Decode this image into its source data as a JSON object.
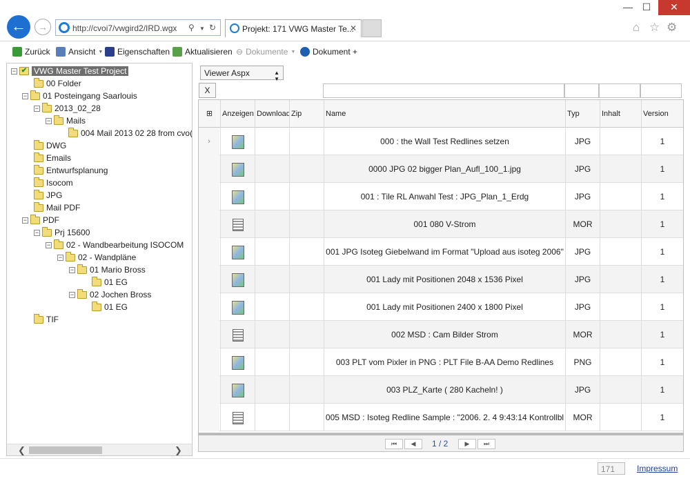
{
  "browser": {
    "url": "http://cvoi7/vwgird2/IRD.wgx",
    "tab_title": "Projekt: 171 VWG Master Te...",
    "win_minimize": "—",
    "win_maximize": "☐",
    "win_close": "✕",
    "tab_close": "✕"
  },
  "toolbar": {
    "back": "Zurück",
    "view": "Ansicht",
    "properties": "Eigenschaften",
    "refresh": "Aktualisieren",
    "documents": "Dokumente",
    "add_document": "Dokument +"
  },
  "tree": {
    "nodes": [
      {
        "label": "VWG Master Test Project"
      },
      {
        "label": "00 Folder"
      },
      {
        "label": "01 Posteingang Saarlouis"
      },
      {
        "label": "2013_02_28"
      },
      {
        "label": "Mails"
      },
      {
        "label": "004 Mail 2013 02 28 from cvo("
      },
      {
        "label": "DWG"
      },
      {
        "label": "Emails"
      },
      {
        "label": "Entwurfsplanung"
      },
      {
        "label": "Isocom"
      },
      {
        "label": "JPG"
      },
      {
        "label": "Mail PDF"
      },
      {
        "label": "PDF"
      },
      {
        "label": "Prj 15600"
      },
      {
        "label": "02 - Wandbearbeitung ISOCOM"
      },
      {
        "label": "02 - Wandpläne"
      },
      {
        "label": "01 Mario Bross"
      },
      {
        "label": "01 EG"
      },
      {
        "label": "02 Jochen Bross"
      },
      {
        "label": "01 EG"
      },
      {
        "label": "TIF"
      }
    ]
  },
  "viewer": {
    "selected": "Viewer Aspx",
    "clear_filter": "X"
  },
  "grid": {
    "columns": [
      "Anzeigen",
      "Download",
      "Zip",
      "Name",
      "Typ",
      "Inhalt",
      "Version"
    ],
    "rows": [
      {
        "name": "000 : the Wall Test Redlines setzen",
        "type": "JPG",
        "version": "1",
        "icon": "image-file-icon"
      },
      {
        "name": "0000 JPG 02 bigger Plan_Aufl_100_1.jpg",
        "type": "JPG",
        "version": "1",
        "icon": "image-file-icon"
      },
      {
        "name": "001 : Tile RL Anwahl Test : JPG_Plan_1_Erdg",
        "type": "JPG",
        "version": "1",
        "icon": "image-file-icon"
      },
      {
        "name": "001 080 V-Strom",
        "type": "MOR",
        "version": "1",
        "icon": "document-file-icon"
      },
      {
        "name": "001 JPG Isoteg Giebelwand im Format \"Upload aus isoteg 2006\"",
        "type": "JPG",
        "version": "1",
        "icon": "image-file-icon"
      },
      {
        "name": "001 Lady mit Positionen 2048 x 1536 Pixel",
        "type": "JPG",
        "version": "1",
        "icon": "image-file-icon"
      },
      {
        "name": "001 Lady mit Positionen 2400 x 1800 Pixel",
        "type": "JPG",
        "version": "1",
        "icon": "image-file-icon"
      },
      {
        "name": "002 MSD : Cam Bilder Strom",
        "type": "MOR",
        "version": "1",
        "icon": "document-file-icon"
      },
      {
        "name": "003 PLT vom Pixler in PNG : PLT File B-AA Demo Redlines",
        "type": "PNG",
        "version": "1",
        "icon": "image-file-icon"
      },
      {
        "name": "003 PLZ_Karte ( 280 Kacheln! )",
        "type": "JPG",
        "version": "1",
        "icon": "image-file-icon"
      },
      {
        "name": "005 MSD : Isoteg Redline Sample : \"2006. 2. 4  9:43:14 Kontrollbl",
        "type": "MOR",
        "version": "1",
        "icon": "document-file-icon"
      }
    ]
  },
  "pager": {
    "page_info": "1 / 2",
    "first": "⏮",
    "prev": "◀",
    "next": "▶",
    "last": "⏭"
  },
  "status": {
    "count": "171",
    "impressum": "Impressum"
  },
  "colors": {
    "accent": "#1d6fd1",
    "selected_node": "#6e6e6e",
    "link": "#1a3fa8"
  }
}
